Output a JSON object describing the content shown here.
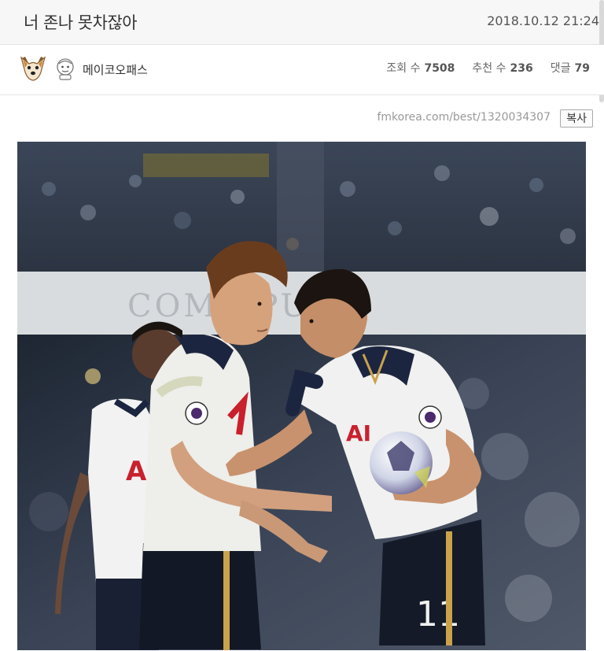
{
  "post": {
    "title": "너 존나 못차잖아",
    "date": "2018.10.12 21:24",
    "author": "메이코오패스",
    "url": "fmkorea.com/best/1320034307",
    "copy_label": "복사"
  },
  "stats": [
    {
      "label": "조회 수",
      "value": "7508"
    },
    {
      "label": "추천 수",
      "value": "236"
    },
    {
      "label": "댓글",
      "value": "79"
    }
  ],
  "photo": {
    "board_text": "COM  SPURS",
    "shirt_number": "11"
  }
}
